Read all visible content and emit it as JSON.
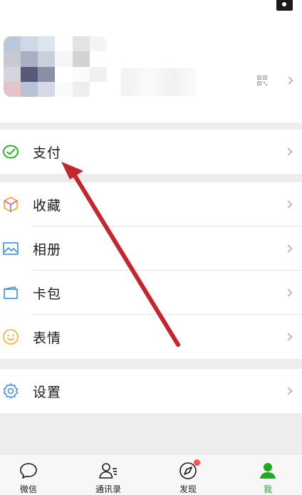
{
  "menu": {
    "pay": {
      "label": "支付"
    },
    "favorites": {
      "label": "收藏"
    },
    "album": {
      "label": "相册"
    },
    "cards": {
      "label": "卡包"
    },
    "stickers": {
      "label": "表情"
    },
    "settings": {
      "label": "设置"
    }
  },
  "tabbar": {
    "tabs": [
      {
        "label": "微信",
        "icon": "chat-bubble-icon"
      },
      {
        "label": "通讯录",
        "icon": "contacts-icon"
      },
      {
        "label": "发现",
        "icon": "compass-icon",
        "badge": "dot"
      },
      {
        "label": "我",
        "icon": "person-icon",
        "active": true
      }
    ]
  },
  "colors": {
    "accent_green": "#1aad19",
    "annotation_arrow": "#c4262e",
    "badge": "#fa5151",
    "background": "#ededed"
  }
}
